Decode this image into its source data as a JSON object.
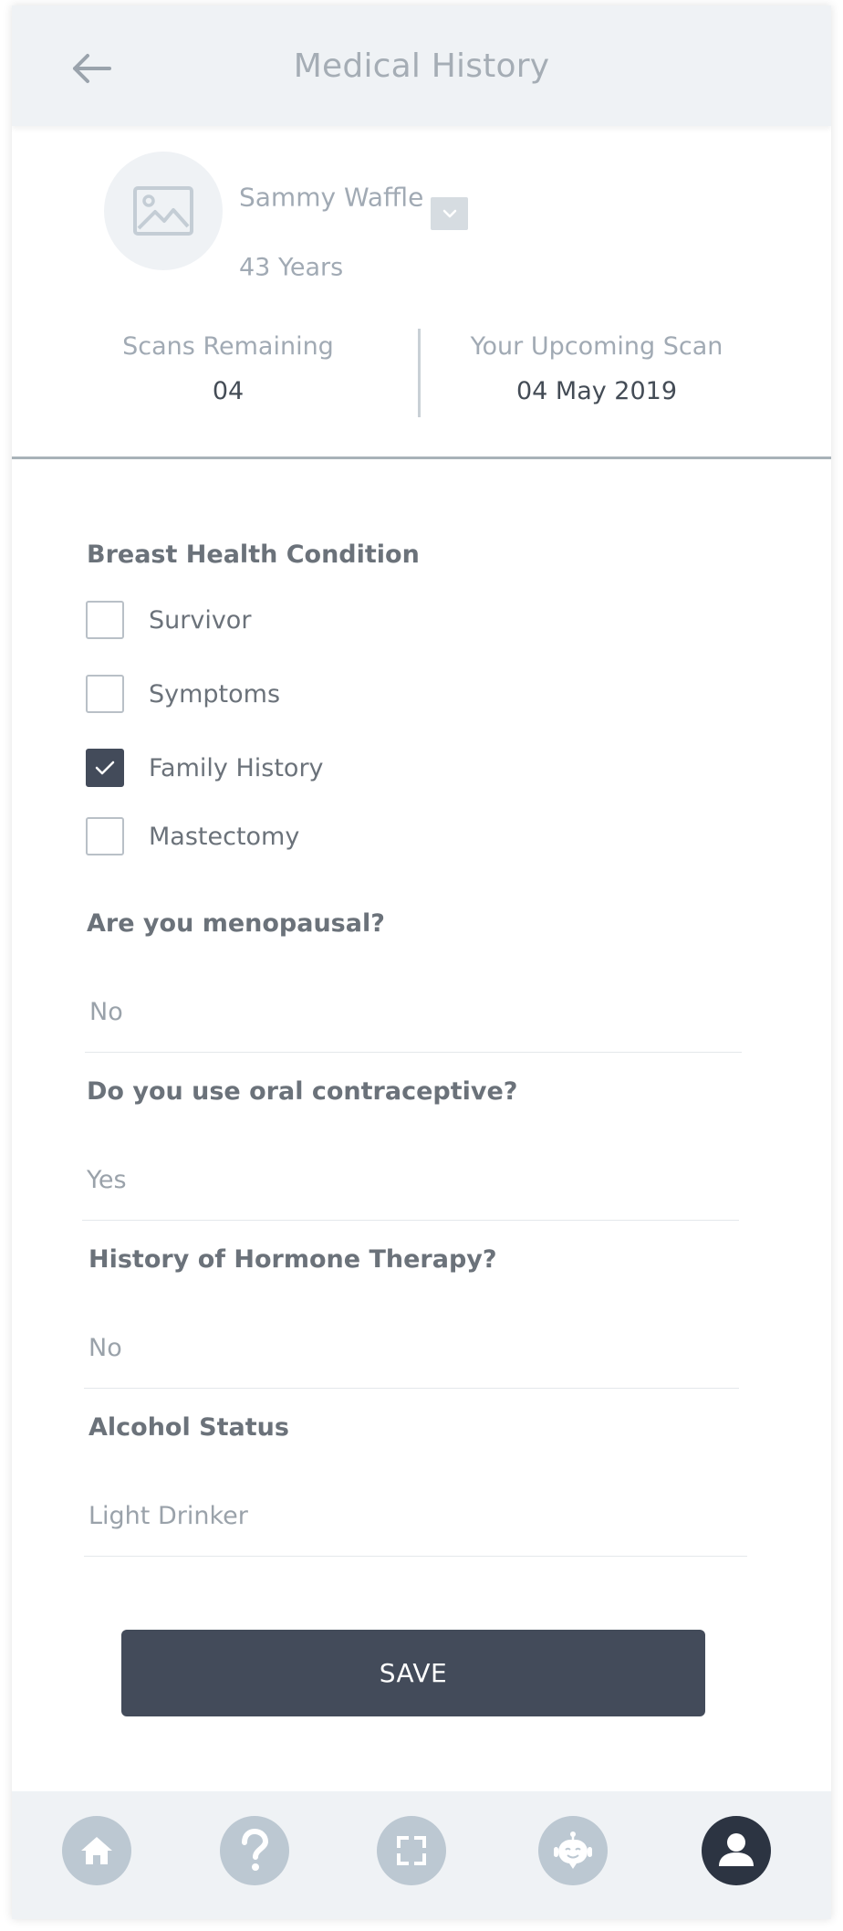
{
  "header": {
    "title": "Medical History"
  },
  "profile": {
    "name": "Sammy Waffle",
    "age": "43 Years"
  },
  "stats": {
    "scans_label": "Scans Remaining",
    "scans_value": "04",
    "upcoming_label": "Your Upcoming Scan",
    "upcoming_value": "04 May 2019"
  },
  "form": {
    "breast_health_label": "Breast Health Condition",
    "conditions": [
      {
        "label": "Survivor",
        "checked": false
      },
      {
        "label": "Symptoms",
        "checked": false
      },
      {
        "label": "Family History",
        "checked": true
      },
      {
        "label": "Mastectomy",
        "checked": false
      }
    ],
    "menopausal_label": "Are you menopausal?",
    "menopausal_value": "No",
    "contraceptive_label": "Do you use oral contraceptive?",
    "contraceptive_value": "Yes",
    "hormone_label": "History of Hormone Therapy?",
    "hormone_value": "No",
    "alcohol_label": "Alcohol Status",
    "alcohol_value": "Light Drinker"
  },
  "save_label": "SAVE",
  "nav": {
    "items": [
      {
        "icon": "home-icon",
        "active": false
      },
      {
        "icon": "help-icon",
        "active": false
      },
      {
        "icon": "scan-icon",
        "active": false
      },
      {
        "icon": "chatbot-icon",
        "active": false
      },
      {
        "icon": "profile-icon",
        "active": true
      }
    ]
  },
  "colors": {
    "header_bg": "#eff2f5",
    "primary_dark": "#434b5a",
    "nav_active": "#2c3442",
    "nav_inactive": "#bcc8d2"
  }
}
